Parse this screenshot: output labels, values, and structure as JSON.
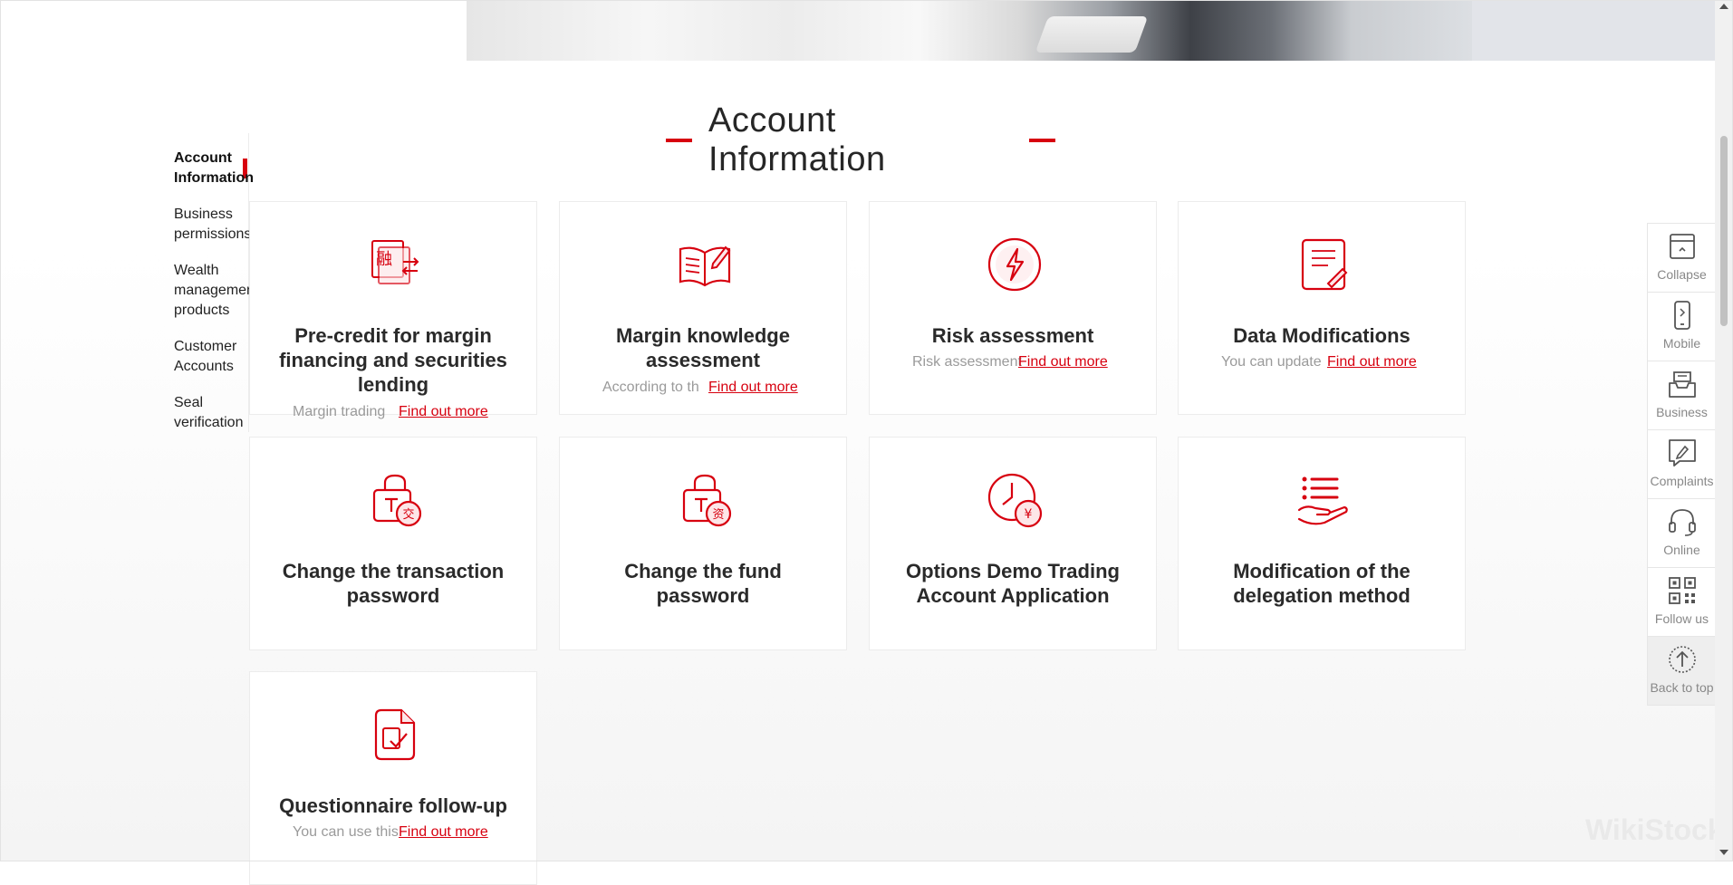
{
  "page": {
    "section_title": "Account Information",
    "watermark": "WikiStock",
    "accent": "#d7000f"
  },
  "sidenav": {
    "items": [
      {
        "label": "Account Information",
        "active": true
      },
      {
        "label": "Business permissions"
      },
      {
        "label": "Wealth management products"
      },
      {
        "label": "Customer Accounts"
      },
      {
        "label": "Seal verification"
      }
    ]
  },
  "cards": [
    {
      "title": "Pre-credit for margin financing and securities lending",
      "desc": "Margin trading",
      "more": "Find out more",
      "icon": "margin-credit-icon",
      "glyph": "融"
    },
    {
      "title": "Margin knowledge assessment",
      "desc": "According to th",
      "more": "Find out more",
      "icon": "open-book-icon"
    },
    {
      "title": "Risk assessment",
      "desc": "Risk assessment",
      "more": "Find out more",
      "icon": "lightning-circle-icon"
    },
    {
      "title": "Data Modifications",
      "desc": "You can update",
      "more": "Find out more",
      "icon": "document-edit-icon"
    },
    {
      "title": "Change the transaction password",
      "icon": "lock-transaction-icon",
      "glyph": "交"
    },
    {
      "title": "Change the fund password",
      "icon": "lock-fund-icon",
      "glyph": "资"
    },
    {
      "title": "Options Demo Trading Account Application",
      "icon": "clock-yen-icon",
      "glyph": "¥"
    },
    {
      "title": "Modification of the delegation method",
      "icon": "hand-list-icon"
    },
    {
      "title": "Questionnaire follow-up",
      "desc": "You can use this",
      "more": "Find out more",
      "icon": "questionnaire-check-icon"
    }
  ],
  "sidebar": {
    "items": [
      {
        "label": "Collapse",
        "icon": "collapse-icon"
      },
      {
        "label": "Mobile",
        "icon": "mobile-icon"
      },
      {
        "label": "Business",
        "icon": "business-tray-icon"
      },
      {
        "label": "Complaints",
        "icon": "complaint-edit-icon"
      },
      {
        "label": "Online",
        "icon": "headset-icon"
      },
      {
        "label": "Follow us",
        "icon": "qr-code-icon"
      },
      {
        "label": "Back to top",
        "icon": "arrow-up-circle-icon"
      }
    ]
  }
}
